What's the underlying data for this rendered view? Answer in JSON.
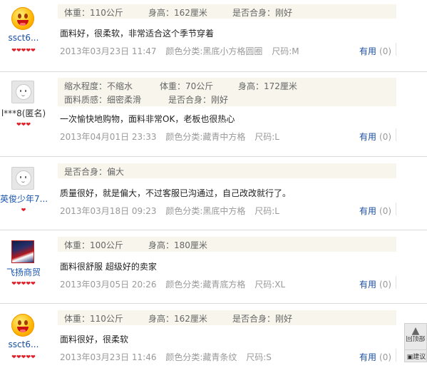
{
  "reviews": [
    {
      "username": "ssct6...",
      "hearts": "❤❤❤❤❤",
      "attributes": [
        "体重：110公斤",
        "身高：162厘米",
        "是否合身：刚好"
      ],
      "content": "面料好，很柔软，非常适合这个季节穿着",
      "date": "2013年03月23日 11:47",
      "color": "颜色分类:黑底小方格圆圈",
      "size": "尺码:M",
      "useful_label": "有用",
      "useful_count": "(0)"
    },
    {
      "username": "l***8(匿名)",
      "hearts": "❤❤❤",
      "attributes_row1": [
        "缩水程度：不缩水",
        "体重：70公斤",
        "身高：172厘米"
      ],
      "attributes_row2": [
        "面料质感：细密柔滑",
        "是否合身：刚好"
      ],
      "content": "一次愉快地购物，面料非常OK，老板也很热心",
      "date": "2013年04月01日 23:33",
      "color": "颜色分类:藏青中方格",
      "size": "尺码:L",
      "useful_label": "有用",
      "useful_count": "(0)"
    },
    {
      "username": "英俊少年7...",
      "hearts": "❤",
      "attributes": [
        "是否合身：偏大"
      ],
      "content": "质量很好，就是偏大，不过客服已沟通过，自己改改就行了。",
      "date": "2013年03月18日 09:23",
      "color": "颜色分类:黑底中方格",
      "size": "尺码:L",
      "useful_label": "有用",
      "useful_count": "(0)"
    },
    {
      "username": "飞扬商贸",
      "hearts": "❤❤❤❤❤",
      "attributes": [
        "体重：100公斤",
        "身高：180厘米"
      ],
      "content": "面料很舒服 超级好的卖家",
      "date": "2013年03月05日 20:26",
      "color": "颜色分类:藏青底方格",
      "size": "尺码:XL",
      "useful_label": "有用",
      "useful_count": "(0)"
    },
    {
      "username": "ssct6...",
      "hearts": "❤❤❤❤❤",
      "attributes": [
        "体重：110公斤",
        "身高：162厘米",
        "是否合身：刚好"
      ],
      "content": "面料很好，很柔软",
      "date": "2013年03月23日 11:46",
      "color": "颜色分类:藏青条纹",
      "size": "尺码:S",
      "useful_label": "有用",
      "useful_count": "(0)"
    }
  ],
  "side_tools": {
    "back_top": "回顶部",
    "suggest": "建议"
  },
  "colors": {
    "link_blue": "#1a4fa0",
    "heart_red": "#e0202a",
    "attr_bg": "#f7f5ec",
    "meta_gray": "#999999"
  }
}
